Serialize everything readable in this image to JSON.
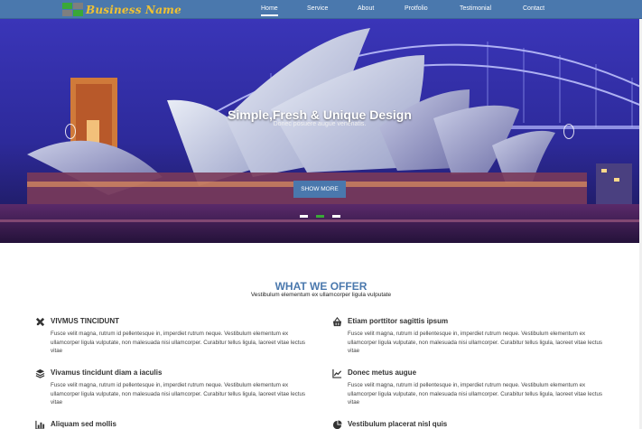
{
  "brand": {
    "name": "Business Name",
    "accent_color": "#4a78ad",
    "logo_colors": [
      "#3aa838",
      "#7f7f7f"
    ]
  },
  "nav": {
    "items": [
      {
        "label": "Home",
        "active": true
      },
      {
        "label": "Service",
        "active": false
      },
      {
        "label": "About",
        "active": false
      },
      {
        "label": "Protfolio",
        "active": false
      },
      {
        "label": "Testimonial",
        "active": false
      },
      {
        "label": "Contact",
        "active": false
      }
    ]
  },
  "hero": {
    "title": "Simple,Fresh & Unique Design",
    "subtitle": "Donec posuere augue venenatis.",
    "button_label": "SHOW MORE",
    "slides": 3,
    "active_slide": 2,
    "image": "sydney-opera-house-night-photo"
  },
  "offer": {
    "heading": "WHAT WE OFFER",
    "subheading": "Vestibulum elementum ex ullamcorper ligula vulputate",
    "features": [
      {
        "icon": "wrench-screwdriver-icon",
        "title": "VIVMUS TINCIDUNT",
        "desc": "Fusce velit magna, rutrum id pellentesque in, imperdiet rutrum neque. Vestibulum elementum ex ullamcorper ligula vulputate, non malesuada nisi ullamcorper. Curabitur tellus ligula, laoreet vitae lectus vitae"
      },
      {
        "icon": "basket-icon",
        "title": "Etiam porttitor sagittis ipsum",
        "desc": "Fusce velit magna, rutrum id pellentesque in, imperdiet rutrum neque. Vestibulum elementum ex ullamcorper ligula vulputate, non malesuada nisi ullamcorper. Curabitur tellus ligula, laoreet vitae lectus vitae"
      },
      {
        "icon": "layers-icon",
        "title": "Vivamus tincidunt diam a iaculis",
        "desc": "Fusce velit magna, rutrum id pellentesque in, imperdiet rutrum neque. Vestibulum elementum ex ullamcorper ligula vulputate, non malesuada nisi ullamcorper. Curabitur tellus ligula, laoreet vitae lectus vitae"
      },
      {
        "icon": "line-chart-icon",
        "title": "Donec metus augue",
        "desc": "Fusce velit magna, rutrum id pellentesque in, imperdiet rutrum neque. Vestibulum elementum ex ullamcorper ligula vulputate, non malesuada nisi ullamcorper. Curabitur tellus ligula, laoreet vitae lectus vitae"
      },
      {
        "icon": "bar-chart-icon",
        "title": "Aliquam sed mollis",
        "desc": ""
      },
      {
        "icon": "pie-chart-icon",
        "title": "Vestibulum placerat nisl quis",
        "desc": ""
      }
    ]
  }
}
